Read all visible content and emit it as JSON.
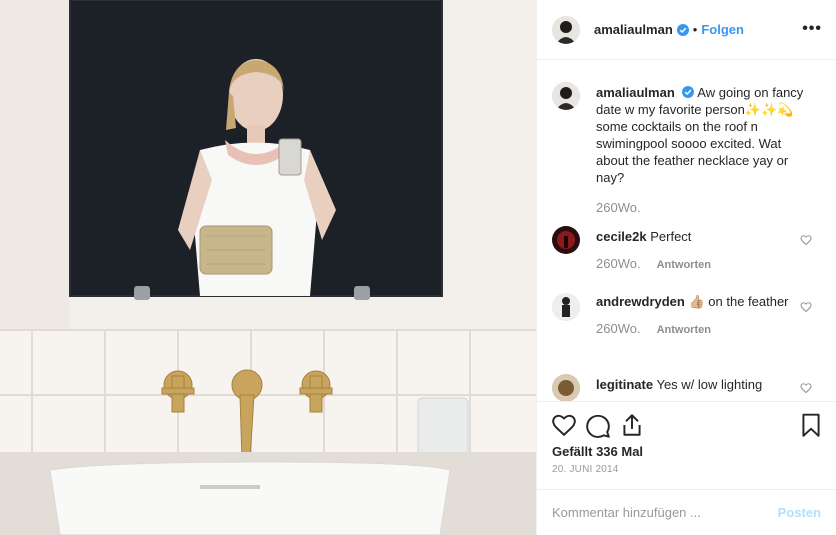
{
  "header": {
    "username": "amaliaulman",
    "dot": "•",
    "follow_label": "Folgen",
    "more_label": "•••"
  },
  "caption": {
    "username": "amaliaulman",
    "text": "Aw going on fancy date w my favorite person✨✨💫 some cocktails on the roof n swimingpool soooo excited. Wat about the feather necklace yay or nay?",
    "time": "260Wo."
  },
  "comments": [
    {
      "username": "cecile2k",
      "text": "Perfect",
      "time": "260Wo.",
      "reply_label": "Antworten"
    },
    {
      "username": "andrewdryden",
      "text": "👍🏼 on the feather",
      "time": "260Wo.",
      "reply_label": "Antworten"
    },
    {
      "username": "legitinate",
      "text": "Yes w/ low lighting",
      "time": "",
      "reply_label": ""
    }
  ],
  "actions": {
    "likes_text": "Gefällt 336 Mal",
    "date": "20. JUNI 2014"
  },
  "add_comment": {
    "placeholder": "Kommentar hinzufügen ...",
    "post_label": "Posten"
  },
  "colors": {
    "link": "#3897f0",
    "muted": "#8e8e8e",
    "post_disabled": "#b2dffc",
    "border": "#efefef"
  },
  "icons": [
    "verified-badge-icon",
    "heart-icon",
    "comment-icon",
    "share-icon",
    "bookmark-icon",
    "more-icon"
  ]
}
